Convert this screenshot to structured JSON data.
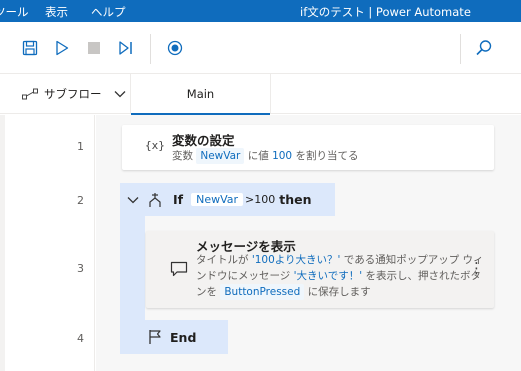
{
  "titlebar": {
    "menu": [
      "ツール",
      "表示",
      "ヘルプ"
    ],
    "title": "if文のテスト | Power Automate"
  },
  "toolbar": {
    "icons": [
      "save-icon",
      "run-icon",
      "stop-icon",
      "run-next-action-icon",
      "record-icon",
      "search-icon"
    ]
  },
  "tabs": {
    "subflow_label": "サブフロー",
    "main_label": "Main"
  },
  "lines": [
    "1",
    "2",
    "3",
    "4"
  ],
  "actions": {
    "set_var": {
      "icon_glyph": "{x}",
      "title": "変数の設定",
      "desc_prefix": "変数",
      "var_name": "NewVar",
      "desc_mid": "に値",
      "value": "100",
      "desc_suffix": "を割り当てる"
    },
    "if_block": {
      "keyword": "If",
      "var_name": "NewVar",
      "condition": ">100",
      "then_kw": "then"
    },
    "message": {
      "title": "メッセージを表示",
      "line1_prefix": "タイトルが",
      "line1_lit": "'100より大きい？'",
      "line1_suffix": "である通知ポップアップ ウィ",
      "line2_prefix": "ンドウにメッセージ",
      "line2_lit": "'大きいです！'",
      "line2_suffix": "を表示し、押されたボタ",
      "line3_prefix": "ンを",
      "line3_var": "ButtonPressed",
      "line3_suffix": "に保存します",
      "more_glyph": "⋮"
    },
    "end_block": {
      "keyword": "End"
    }
  }
}
